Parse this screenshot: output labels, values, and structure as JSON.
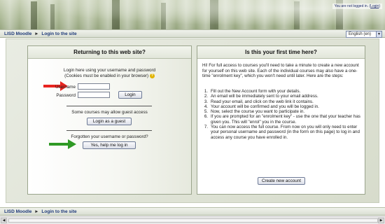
{
  "header": {
    "login_status_prefix": "You are not logged in. (",
    "login_link": "Login",
    "login_status_suffix": ")"
  },
  "navbar": {
    "site": "LISD Moodle",
    "separator": "►",
    "page": "Login to the site",
    "language": "English (en)"
  },
  "login_panel": {
    "title": "Returning to this web site?",
    "intro_line1": "Login here using your username and password",
    "intro_line2": "(Cookies must be enabled in your browser)",
    "username_label": "Username",
    "password_label": "Password",
    "username_value": "",
    "password_value": "",
    "login_button": "Login",
    "guest_text": "Some courses may allow guest access",
    "guest_button": "Login as a guest",
    "forgot_text": "Forgotten your username or password?",
    "forgot_button": "Yes, help me log in"
  },
  "signup_panel": {
    "title": "Is this your first time here?",
    "intro": "Hi! For full access to courses you'll need to take a minute to create a new account for yourself on this web site. Each of the individual courses may also have a one-time \"enrolment key\", which you won't need until later. Here are the steps:",
    "steps": [
      {
        "num": "1.",
        "text": "Fill out the New Account form with your details."
      },
      {
        "num": "2.",
        "text": "An email will be immediately sent to your email address."
      },
      {
        "num": "3.",
        "text": "Read your email, and click on the web link it contains."
      },
      {
        "num": "4.",
        "text": "Your account will be confirmed and you will be logged in."
      },
      {
        "num": "5.",
        "text": "Now, select the course you want to participate in."
      },
      {
        "num": "6.",
        "text": "If you are prompted for an \"enrolment key\" - use the one that your teacher has given you. This will \"enrol\" you in the course."
      },
      {
        "num": "7.",
        "text": "You can now access the full course. From now on you will only need to enter your personal username and password (in the form on this page) to log in and access any course you have enrolled in."
      }
    ],
    "create_button": "Create new account"
  },
  "footer": {
    "site": "LISD Moodle",
    "separator": "►",
    "page": "Login to the site"
  },
  "colors": {
    "arrow_red": "#e8241f",
    "arrow_green": "#2f9a25",
    "link_blue": "#1f3a7a"
  }
}
